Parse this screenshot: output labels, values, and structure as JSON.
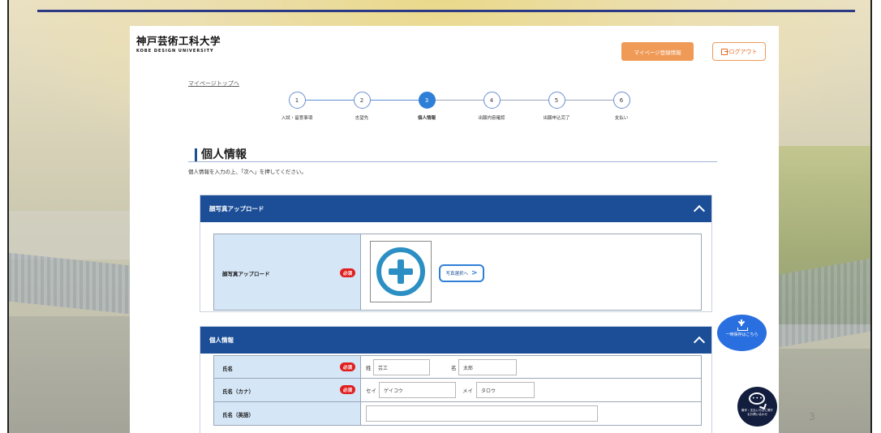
{
  "university": {
    "name_jp": "神戸芸術工科大学",
    "name_en": "KOBE DESIGN UNIVERSITY"
  },
  "header": {
    "mypage_button": "マイページ登録情報",
    "logout_button": "ログアウト"
  },
  "breadcrumb": "マイページトップへ",
  "stepper": {
    "current": 3,
    "steps": [
      {
        "num": "1",
        "label": "入試・留意事項"
      },
      {
        "num": "2",
        "label": "志望先"
      },
      {
        "num": "3",
        "label": "個人情報"
      },
      {
        "num": "4",
        "label": "出願内容確認"
      },
      {
        "num": "5",
        "label": "出願申込完了"
      },
      {
        "num": "6",
        "label": "支払い"
      }
    ]
  },
  "page": {
    "title": "個人情報",
    "intro": "個人情報を入力の上、「次へ」を押してください。"
  },
  "photo_section": {
    "header": "顔写真アップロード",
    "label": "顔写真アップロード",
    "required": "必須",
    "select_button": "写真選択へ"
  },
  "personal_section": {
    "header": "個人情報",
    "rows": [
      {
        "label": "氏名",
        "required": "必須",
        "prefix1": "姓",
        "value1": "芸工",
        "prefix2": "名",
        "value2": "太郎"
      },
      {
        "label": "氏名（カナ）",
        "required": "必須",
        "prefix1": "セイ",
        "value1": "ゲイコウ",
        "prefix2": "メイ",
        "value2": "タロウ"
      },
      {
        "label": "氏名（英語）",
        "value1": ""
      }
    ]
  },
  "floating": {
    "save_button": "一時保存はこちら",
    "chat_button": "操作・支払い方法に関するお問い合わせ"
  },
  "slide_number": "3",
  "colors": {
    "navy": "#1b4e97",
    "orange": "#f09a57",
    "required_red": "#e02020",
    "label_bg": "#d5e6f6",
    "step_active": "#2f7fd8"
  }
}
